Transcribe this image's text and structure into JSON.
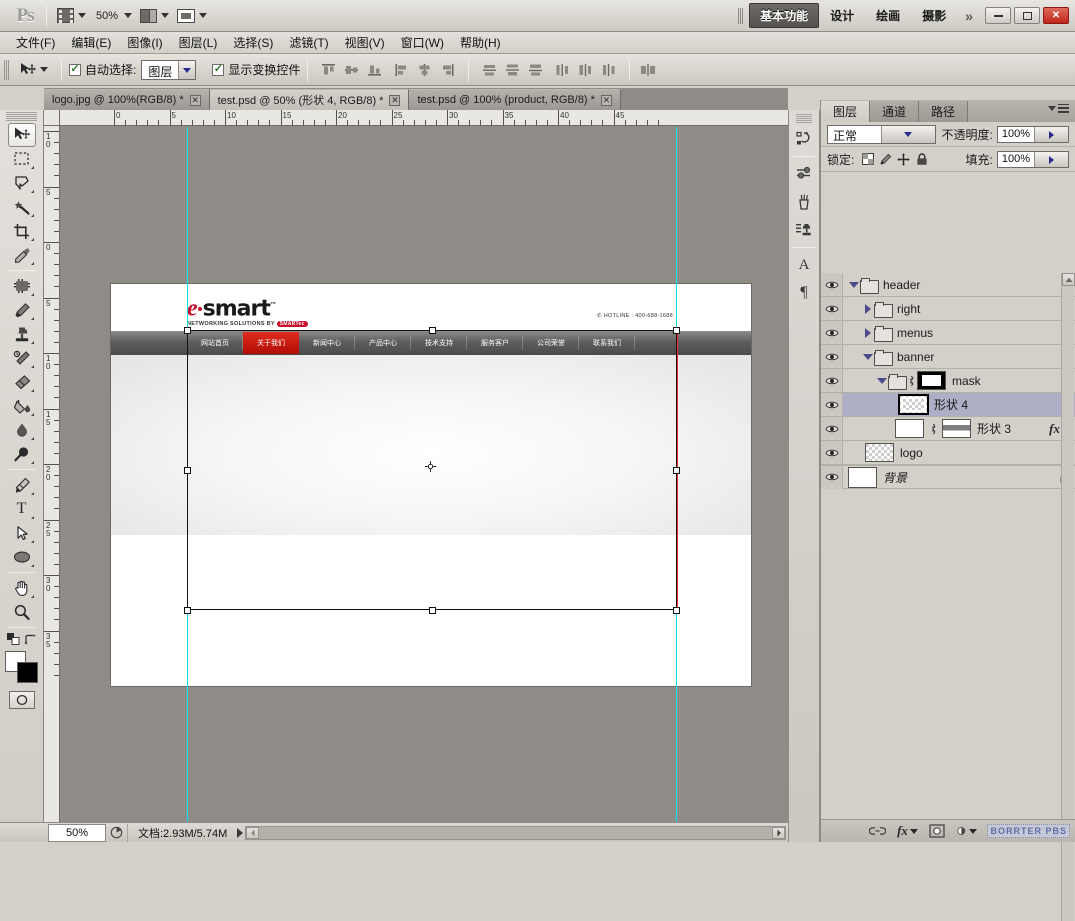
{
  "app": {
    "logo": "Ps"
  },
  "topbar": {
    "zoom_level": "50%",
    "icons": [
      "bridge-icon",
      "view-extras-icon",
      "zoom-dropdown",
      "arrange-documents-icon",
      "screen-mode-icon"
    ],
    "workspaces": [
      {
        "label": "基本功能",
        "active": true
      },
      {
        "label": "设计",
        "active": false
      },
      {
        "label": "绘画",
        "active": false
      },
      {
        "label": "摄影",
        "active": false
      }
    ],
    "more": "»",
    "window_buttons": {
      "minimize": "minimize-button",
      "maximize": "maximize-button",
      "close": "✕"
    }
  },
  "menubar": {
    "items": [
      {
        "text": "文件(F)",
        "label": "文件",
        "key": "F"
      },
      {
        "text": "编辑(E)",
        "label": "编辑",
        "key": "E"
      },
      {
        "text": "图像(I)",
        "label": "图像",
        "key": "I"
      },
      {
        "text": "图层(L)",
        "label": "图层",
        "key": "L"
      },
      {
        "text": "选择(S)",
        "label": "选择",
        "key": "S"
      },
      {
        "text": "滤镜(T)",
        "label": "滤镜",
        "key": "T"
      },
      {
        "text": "视图(V)",
        "label": "视图",
        "key": "V"
      },
      {
        "text": "窗口(W)",
        "label": "窗口",
        "key": "W"
      },
      {
        "text": "帮助(H)",
        "label": "帮助",
        "key": "H"
      }
    ]
  },
  "optionsbar": {
    "tool": "move-tool",
    "auto_select_label": "自动选择:",
    "auto_select_checked": true,
    "auto_select_value": "图层",
    "show_transform_label": "显示变换控件",
    "show_transform_checked": true,
    "align_buttons": [
      "align-top-edges",
      "align-vertical-centers",
      "align-bottom-edges",
      "align-left-edges",
      "align-horizontal-centers",
      "align-right-edges"
    ],
    "distribute_buttons": [
      "distribute-top-edges",
      "distribute-vertical-centers",
      "distribute-bottom-edges",
      "distribute-left-edges",
      "distribute-horizontal-centers",
      "distribute-right-edges"
    ],
    "auto_align_button": "auto-align-layers"
  },
  "documents": {
    "tabs": [
      {
        "title": "logo.jpg @ 100%(RGB/8) *",
        "active": false
      },
      {
        "title": "test.psd @ 50% (形状 4, RGB/8) *",
        "active": true
      },
      {
        "title": "test.psd @ 100% (product, RGB/8) *",
        "active": false
      }
    ],
    "close_glyph": "✕"
  },
  "toolbox": {
    "tools": [
      {
        "name": "move-tool",
        "selected": true,
        "has_flyout": false
      },
      {
        "name": "rectangular-marquee-tool",
        "selected": false,
        "has_flyout": true
      },
      {
        "name": "lasso-tool",
        "selected": false,
        "has_flyout": true
      },
      {
        "name": "magic-wand-tool",
        "selected": false,
        "has_flyout": true
      },
      {
        "name": "crop-tool",
        "selected": false,
        "has_flyout": true
      },
      {
        "name": "eyedropper-tool",
        "selected": false,
        "has_flyout": true
      },
      {
        "name": "spot-healing-brush-tool",
        "selected": false,
        "has_flyout": true
      },
      {
        "name": "brush-tool",
        "selected": false,
        "has_flyout": true
      },
      {
        "name": "clone-stamp-tool",
        "selected": false,
        "has_flyout": true
      },
      {
        "name": "history-brush-tool",
        "selected": false,
        "has_flyout": true
      },
      {
        "name": "eraser-tool",
        "selected": false,
        "has_flyout": true
      },
      {
        "name": "gradient-tool",
        "selected": false,
        "has_flyout": true
      },
      {
        "name": "blur-tool",
        "selected": false,
        "has_flyout": true
      },
      {
        "name": "dodge-tool",
        "selected": false,
        "has_flyout": true
      },
      {
        "name": "pen-tool",
        "selected": false,
        "has_flyout": true
      },
      {
        "name": "horizontal-type-tool",
        "selected": false,
        "has_flyout": true,
        "glyph": "T"
      },
      {
        "name": "path-selection-tool",
        "selected": false,
        "has_flyout": true
      },
      {
        "name": "ellipse-shape-tool",
        "selected": false,
        "has_flyout": true
      },
      {
        "name": "hand-tool",
        "selected": false,
        "has_flyout": true
      },
      {
        "name": "zoom-tool",
        "selected": false,
        "has_flyout": false
      }
    ],
    "foreground_color": "#ffffff",
    "background_color": "#000000",
    "quick_mask": "edit-in-quick-mask-mode"
  },
  "rulers": {
    "unit_note": "",
    "horizontal_labels": [
      "0",
      "5",
      "10",
      "15",
      "20",
      "25",
      "30",
      "35",
      "40",
      "45"
    ],
    "vertical_labels": [
      "-10",
      "-5",
      "0",
      "5",
      "10",
      "15",
      "20",
      "25",
      "30",
      "35"
    ]
  },
  "canvas": {
    "zoom": "50%",
    "guides": [
      "vertical-guide-left",
      "vertical-guide-right",
      "vertical-guide-red"
    ],
    "transform": {
      "visible": true,
      "handles": 8,
      "reference_point": "center"
    },
    "site": {
      "logo": {
        "e": "e",
        "word": "smart",
        "tm": "™",
        "tagline": "NETWORKING SOLUTIONS BY",
        "badge": "SMARTec"
      },
      "hotline": "HOTLINE : 400-688-1688",
      "nav": [
        {
          "label": "网站首页",
          "active": false
        },
        {
          "label": "关于我们",
          "active": true
        },
        {
          "label": "新闻中心",
          "active": false
        },
        {
          "label": "产品中心",
          "active": false
        },
        {
          "label": "技术支持",
          "active": false
        },
        {
          "label": "服务客户",
          "active": false
        },
        {
          "label": "公司荣誉",
          "active": false
        },
        {
          "label": "联系我们",
          "active": false
        }
      ]
    }
  },
  "dockstrip": {
    "icons": [
      "history-panel-icon",
      "adjustments-panel-icon",
      "brush-panel-icon",
      "clone-source-panel-icon",
      "character-panel-icon",
      "paragraph-panel-icon"
    ],
    "character_glyph": "A",
    "paragraph_glyph": "¶"
  },
  "layers_panel": {
    "tabs": [
      {
        "label": "图层",
        "active": true
      },
      {
        "label": "通道",
        "active": false
      },
      {
        "label": "路径",
        "active": false
      }
    ],
    "menu_icon": "panel-menu-icon",
    "blend_mode": "正常",
    "opacity_label": "不透明度:",
    "opacity_value": "100%",
    "lock_label": "锁定:",
    "lock_icons": [
      "lock-transparent-pixels",
      "lock-image-pixels",
      "lock-position",
      "lock-all"
    ],
    "fill_label": "填充:",
    "fill_value": "100%",
    "layers": [
      {
        "name": "header",
        "type": "group",
        "indent": 0,
        "expanded": true,
        "visible": true,
        "selected": false,
        "thumb": "none"
      },
      {
        "name": "right",
        "type": "group",
        "indent": 1,
        "expanded": false,
        "visible": true,
        "selected": false,
        "thumb": "none"
      },
      {
        "name": "menus",
        "type": "group",
        "indent": 1,
        "expanded": false,
        "visible": true,
        "selected": false,
        "thumb": "none"
      },
      {
        "name": "banner",
        "type": "group",
        "indent": 1,
        "expanded": true,
        "visible": true,
        "selected": false,
        "thumb": "none"
      },
      {
        "name": "mask",
        "type": "group",
        "indent": 2,
        "expanded": true,
        "visible": true,
        "selected": false,
        "thumb": "mask",
        "linked": true
      },
      {
        "name": "形状 4",
        "type": "layer",
        "indent": 3,
        "visible": true,
        "selected": true,
        "thumb": "transparent"
      },
      {
        "name": "形状 3",
        "type": "layer",
        "indent": 3,
        "visible": true,
        "selected": false,
        "thumb": "shape",
        "linked": true,
        "has_fx": true,
        "fx_glyph": "fx"
      },
      {
        "name": "logo",
        "type": "layer",
        "indent": 2,
        "visible": true,
        "selected": false,
        "thumb": "transparent"
      },
      {
        "name": "背景",
        "type": "layer",
        "indent": 0,
        "visible": true,
        "selected": false,
        "thumb": "white",
        "locked": true
      }
    ],
    "bottom_buttons": [
      "link-layers-button",
      "add-layer-style-button",
      "add-layer-mask-button",
      "create-adjustment-layer-button"
    ],
    "watermark": "BORRTER PBS"
  },
  "statusbar": {
    "zoom": "50%",
    "doc_info": "文档:2.93M/5.74M",
    "expand_glyph": "▶"
  }
}
